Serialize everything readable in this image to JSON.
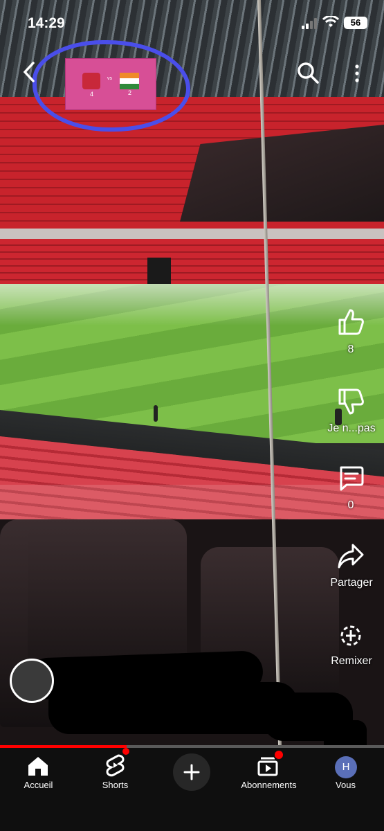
{
  "status_bar": {
    "time": "14:29",
    "battery": "56"
  },
  "scoreboard": {
    "score_left": "4",
    "vs": "vs",
    "score_right": "2"
  },
  "actions": {
    "like_count": "8",
    "dislike_label": "Je n...pas",
    "comment_count": "0",
    "share_label": "Partager",
    "remix_label": "Remixer"
  },
  "progress": {
    "fraction": 0.33
  },
  "nav": {
    "items": [
      {
        "label": "Accueil",
        "icon": "home-icon"
      },
      {
        "label": "Shorts",
        "icon": "shorts-icon"
      },
      {
        "label": "",
        "icon": "create-icon"
      },
      {
        "label": "Abonnements",
        "icon": "subscriptions-icon"
      },
      {
        "label": "Vous",
        "icon": "avatar-icon"
      }
    ],
    "avatar_letter": "H"
  },
  "colors": {
    "accent": "#ff0000",
    "annotation": "#4a4eea",
    "nav_bg": "#0f0f0f"
  }
}
